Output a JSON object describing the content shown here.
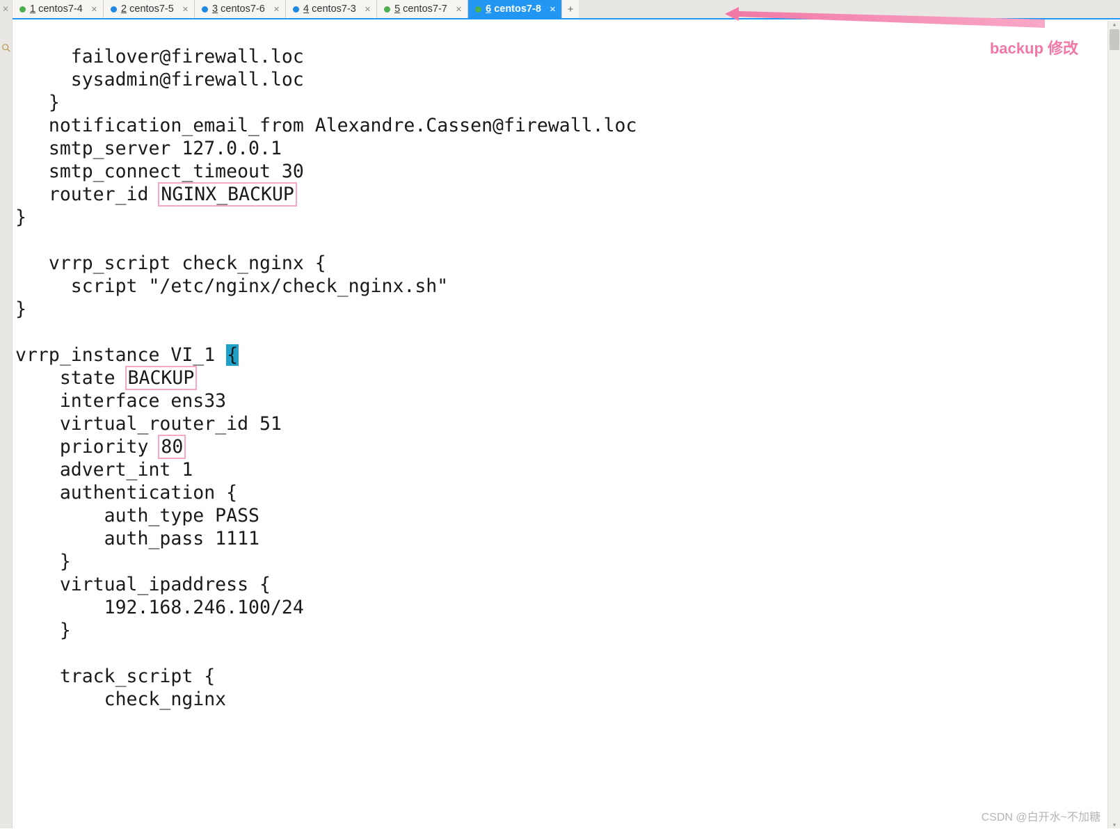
{
  "tabs": [
    {
      "index": "1",
      "label": "centos7-4",
      "dot": "green",
      "active": false
    },
    {
      "index": "2",
      "label": "centos7-5",
      "dot": "blue",
      "active": false
    },
    {
      "index": "3",
      "label": "centos7-6",
      "dot": "blue",
      "active": false
    },
    {
      "index": "4",
      "label": "centos7-3",
      "dot": "blue",
      "active": false
    },
    {
      "index": "5",
      "label": "centos7-7",
      "dot": "green",
      "active": false
    },
    {
      "index": "6",
      "label": "centos7-8",
      "dot": "green",
      "active": true
    }
  ],
  "annotation": "backup 修改",
  "watermark": "CSDN @白开水~不加糖",
  "code": {
    "l01": "     failover@firewall.loc",
    "l02": "     sysadmin@firewall.loc",
    "l03": "   }",
    "l04a": "   notification_email_from Alexandre.Cassen@firewall.loc",
    "l05": "   smtp_server 127.0.0.1",
    "l06": "   smtp_connect_timeout 30",
    "l07a": "   router_id ",
    "l07b": "NGINX_BACKUP",
    "l08": "}",
    "l09": "",
    "l10": "   vrrp_script check_nginx {",
    "l11": "     script \"/etc/nginx/check_nginx.sh\"",
    "l12": "}",
    "l13": "",
    "l14a": "vrrp_instance VI_1 ",
    "l14b": "{",
    "l15a": "    state ",
    "l15b": "BACKUP",
    "l16": "    interface ens33",
    "l17": "    virtual_router_id 51",
    "l18a": "    priority ",
    "l18b": "80",
    "l19": "    advert_int 1",
    "l20": "    authentication {",
    "l21": "        auth_type PASS",
    "l22": "        auth_pass 1111",
    "l23": "    }",
    "l24": "    virtual_ipaddress {",
    "l25": "        192.168.246.100/24",
    "l26": "    }",
    "l27": "",
    "l28": "    track_script {",
    "l29": "        check_nginx"
  }
}
